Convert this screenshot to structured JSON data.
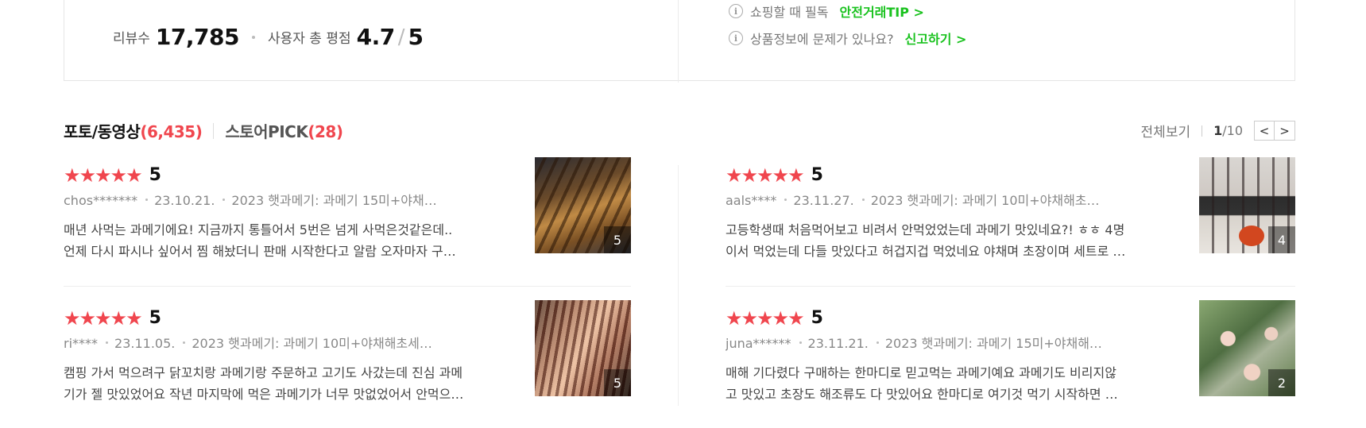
{
  "summary": {
    "review_count_label": "리뷰수",
    "review_count": "17,785",
    "rating_label": "사용자 총 평점",
    "rating": "4.7",
    "rating_sep": "/",
    "rating_max": "5",
    "notices": [
      {
        "text": "쇼핑할 때 필독",
        "link": "안전거래TIP >"
      },
      {
        "text": "상품정보에 문제가 있나요?",
        "link": "신고하기 >"
      }
    ]
  },
  "tabs": [
    {
      "label": "포토/동영상",
      "count": "(6,435)"
    },
    {
      "label": "스토어PICK",
      "count": "(28)"
    }
  ],
  "paging": {
    "view_all": "전체보기",
    "current": "1",
    "total": "/10",
    "prev": "<",
    "next": ">"
  },
  "colors": {
    "accent_red": "#f0464e",
    "accent_green": "#19c21e"
  },
  "reviews": [
    {
      "score": "5",
      "user": "chos*******",
      "date": "23.10.21.",
      "option": "2023 햇과메기: 과메기 15미+야채…",
      "line1": "매년 사먹는 과메기에요! 지금까지 통틀어서 5번은 넘게 사먹은것같은데..",
      "line2": "언제 다시 파시나 싶어서 찜 해놨더니 판매 시작한다고 알람 오자마자 구…",
      "photo_count": "5"
    },
    {
      "score": "5",
      "user": "aals****",
      "date": "23.11.27.",
      "option": "2023 햇과메기: 과메기 10미+야채해초…",
      "line1": "고등학생때 처음먹어보고 비려서 안먹었었는데 과메기 맛있네요?! ㅎㅎ 4명",
      "line2": "이서 먹었는데 다들 맛있다고 허겁지겁 먹었네요 야채며 초장이며 세트로 …",
      "photo_count": "4"
    },
    {
      "score": "5",
      "user": "ri****",
      "date": "23.11.05.",
      "option": "2023 햇과메기: 과메기 10미+야채해초세…",
      "line1": "캠핑 가서 먹으려구 닭꼬치랑 과메기랑 주문하고 고기도 사갔는데 진심 과메",
      "line2": "기가 젤 맛있었어요 작년 마지막에 먹은 과메기가 너무 맛없었어서 안먹으…",
      "photo_count": "5"
    },
    {
      "score": "5",
      "user": "juna******",
      "date": "23.11.21.",
      "option": "2023 햇과메기: 과메기 15미+야채해…",
      "line1": "매해 기다렸다 구매하는 한마디로 믿고먹는 과메기예요 과메기도 비리지않",
      "line2": "고 맛있고 초장도 해조류도 다 맛있어요 한마디로 여기것 먹기 시작하면 …",
      "photo_count": "2"
    }
  ]
}
